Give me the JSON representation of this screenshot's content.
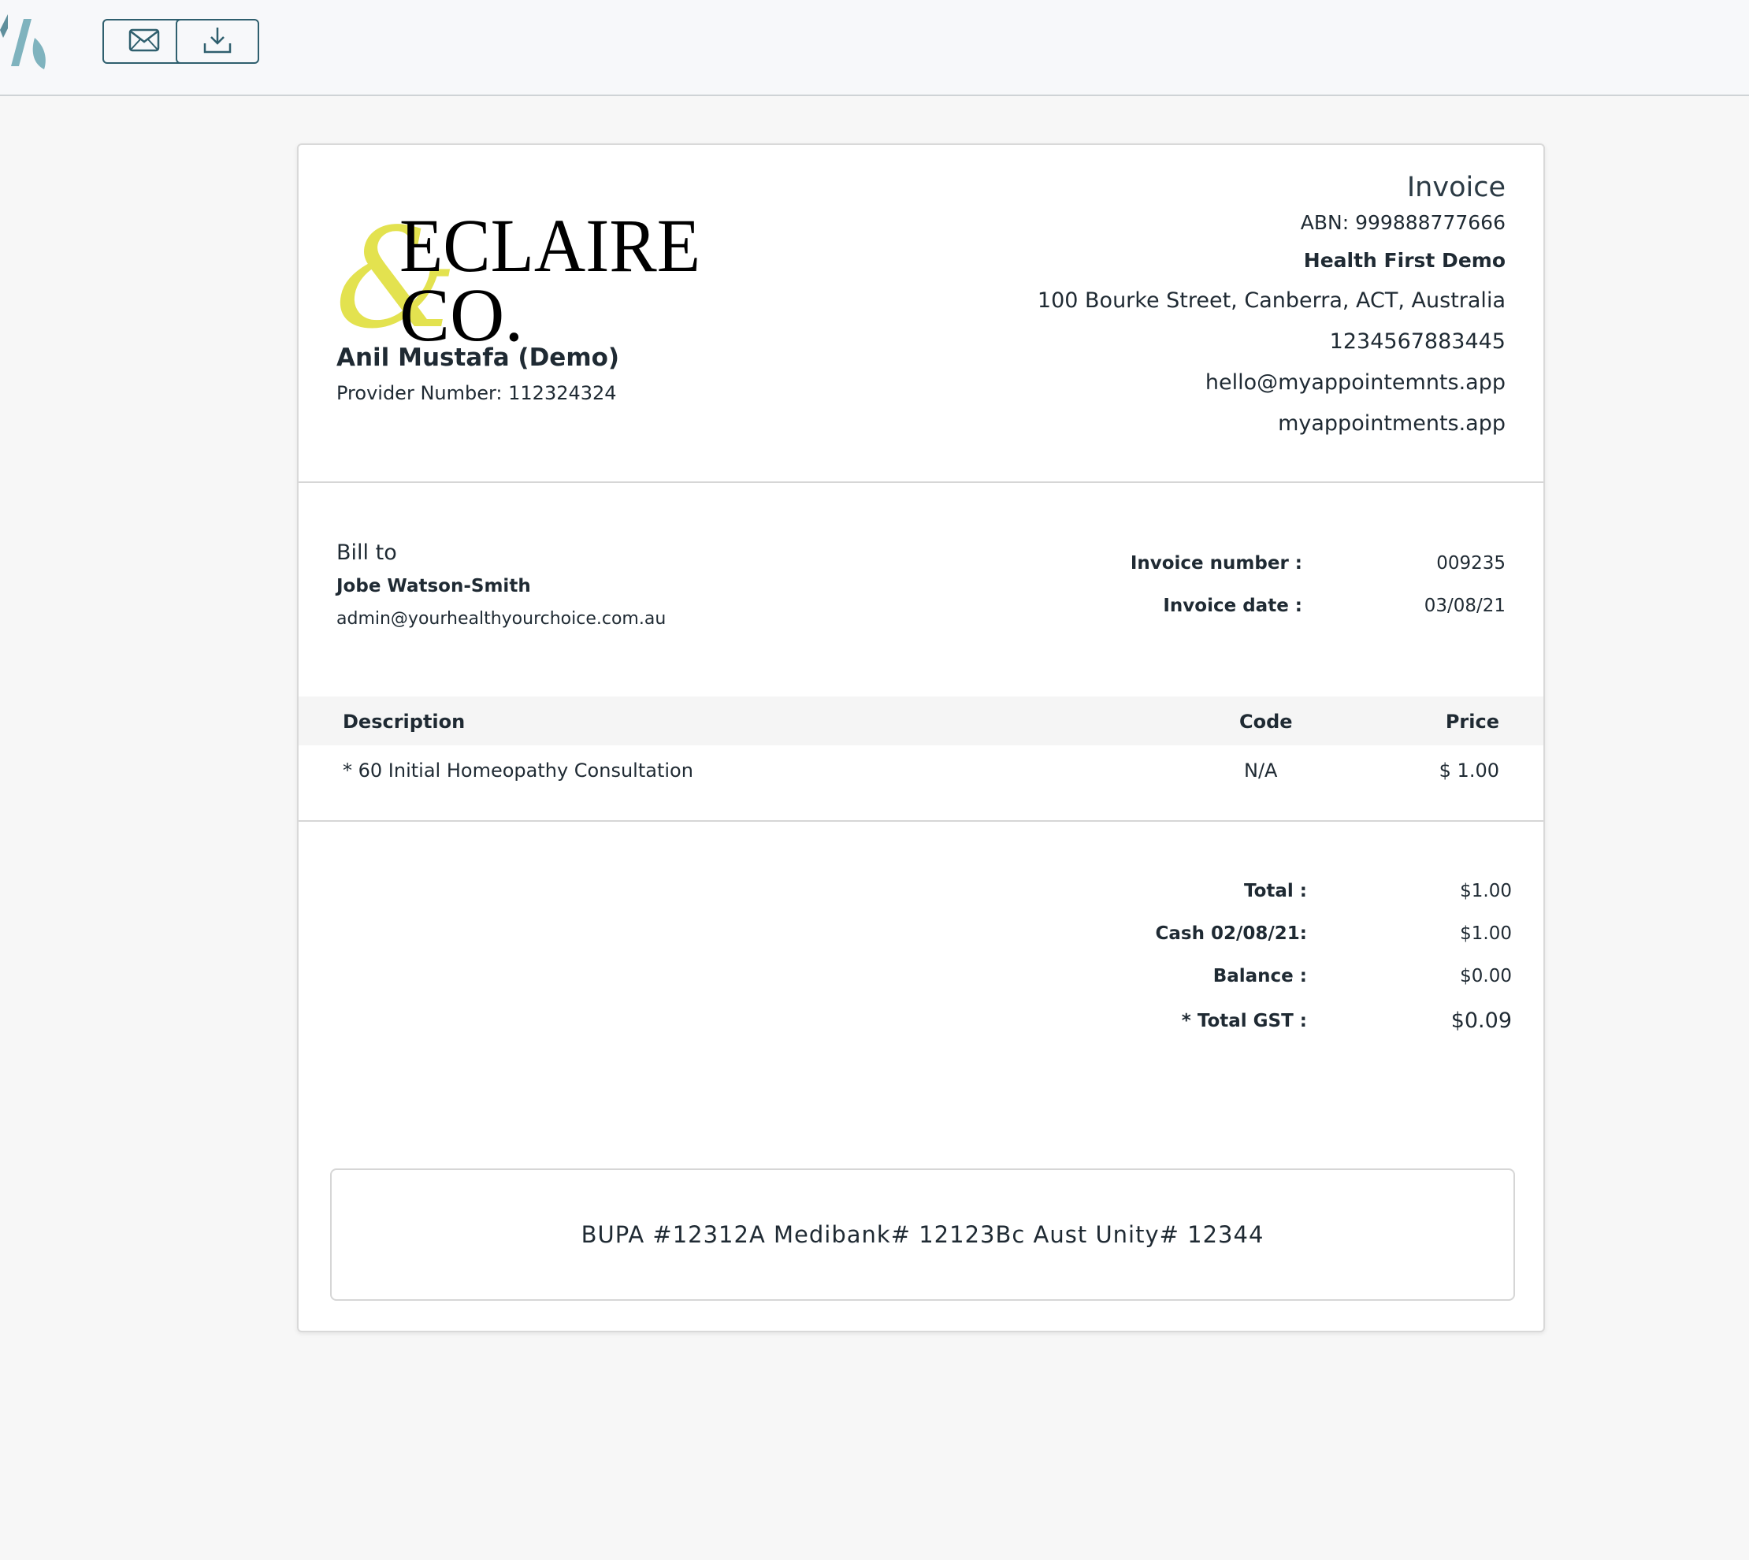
{
  "toolbar": {
    "email_icon": "envelope-icon",
    "download_icon": "download-icon"
  },
  "brand": {
    "logo_text_line1": "ECLAIRE",
    "logo_text_line2": "CO.",
    "logo_ampersand": "&",
    "accent_color": "#e3e24f",
    "app_logo_color": "#7fb3be"
  },
  "provider": {
    "name": "Anil Mustafa (Demo)",
    "number": "Provider Number: 112324324"
  },
  "business": {
    "title": "Invoice",
    "abn": "ABN: 999888777666",
    "name": "Health First Demo",
    "address": "100 Bourke Street, Canberra, ACT, Australia",
    "phone": "1234567883445",
    "email": "hello@myappointemnts.app",
    "website": "myappointments.app"
  },
  "bill_to": {
    "label": "Bill to",
    "name": "Jobe Watson-Smith",
    "email": "admin@yourhealthyourchoice.com.au"
  },
  "invoice_meta": {
    "number_label": "Invoice number :",
    "number_value": "009235",
    "date_label": "Invoice date :",
    "date_value": "03/08/21"
  },
  "table": {
    "headers": [
      "Description",
      "Code",
      "Price"
    ],
    "rows": [
      [
        "* 60 Initial Homeopathy Consultation",
        "N/A",
        "$ 1.00"
      ]
    ]
  },
  "totals": {
    "total_label": "Total :",
    "total_value": "$1.00",
    "cash_label": "Cash 02/08/21:",
    "cash_value": "$1.00",
    "balance_label": "Balance :",
    "balance_value": "$0.00",
    "gst_label": "* Total GST :",
    "gst_value": "$0.09"
  },
  "note": "BUPA #12312A Medibank# 12123Bc Aust Unity# 12344"
}
